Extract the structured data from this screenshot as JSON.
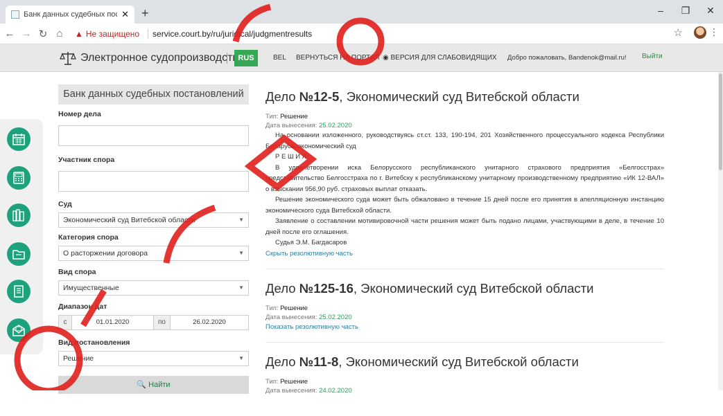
{
  "browser": {
    "tab_title": "Банк данных судебных постано",
    "tab_close": "✕",
    "newtab": "+",
    "win_min": "–",
    "win_max": "❐",
    "win_close": "✕",
    "security_label": "Не защищено",
    "url": "service.court.by/ru/juridical/judgmentresults"
  },
  "header": {
    "brand": "Электронное судопроизводство",
    "lang_rus": "RUS",
    "lang_bel": "BEL",
    "back_portal": "ВЕРНУТЬСЯ НА ПОРТАЛ",
    "low_vision": "◉ ВЕРСИЯ ДЛЯ СЛАБОВИДЯЩИХ",
    "welcome": "Добро пожаловать, Bandenok@mail.ru!",
    "logout": "Выйти"
  },
  "sidebar_icons": [
    "calendar-icon",
    "calculator-icon",
    "books-icon",
    "folder-icon",
    "document-icon",
    "envelope-icon"
  ],
  "form": {
    "title": "Банк данных судебных постановлений",
    "case_number_label": "Номер дела",
    "participant_label": "Участник спора",
    "court_label": "Суд",
    "court_value": "Экономический суд Витебской области",
    "category_label": "Категория спора",
    "category_value": "О расторжении договора",
    "dispute_type_label": "Вид спора",
    "dispute_type_value": "Имущественные",
    "date_range_label": "Диапазон дат",
    "date_from_addon": "с",
    "date_from": "01.01.2020",
    "date_to_addon": "по",
    "date_to": "26.02.2020",
    "ruling_type_label": "Вид постановления",
    "ruling_type_value": "Решение",
    "search_button": "🔍 Найти"
  },
  "results": [
    {
      "title_prefix": "Дело ",
      "number": "№12-5",
      "title_suffix": ", Экономический суд Витебской области",
      "type_label": "Тип: ",
      "type_value": "Решение",
      "date_label": "Дата вынесения: ",
      "date_value": "25.02.2020",
      "paragraphs": [
        "На основании изложенного, руководствуясь ст.ст. 133, 190-194, 201 Хозяйственного процессуального кодекса Республики Беларусь, экономический суд",
        "Р Е Ш И Л:",
        "В удовлетворении иска Белорусского республиканского унитарного страхового предприятия «Белгосстрах» представительство Белгосстраха по г. Витебску к республиканскому унитарному производственному предприятию «ИК 12-ВАЛ» о взыскании 956,90 руб. страховых выплат отказать.",
        "Решение экономического суда может быть обжаловано в течение 15 дней после его принятия в апелляционную инстанцию экономического суда Витебской области.",
        "Заявление о составлении мотивировочной части решения может быть подано лицами, участвующими в деле, в течение 10 дней после его оглашения.",
        "Судья Э.М. Багдасаров"
      ],
      "toggle": "Скрыть резолютивную часть"
    },
    {
      "title_prefix": "Дело ",
      "number": "№125-16",
      "title_suffix": ", Экономический суд Витебской области",
      "type_label": "Тип: ",
      "type_value": "Решение",
      "date_label": "Дата вынесения: ",
      "date_value": "25.02.2020",
      "toggle": "Показать резолютивную часть"
    },
    {
      "title_prefix": "Дело ",
      "number": "№11-8",
      "title_suffix": ", Экономический суд Витебской области",
      "type_label": "Тип: ",
      "type_value": "Решение",
      "date_label": "Дата вынесения: ",
      "date_value": "24.02.2020"
    }
  ],
  "colors": {
    "accent": "#1ea27d",
    "lang_active": "#34a853",
    "date": "#2a9d5a",
    "link": "#2a7f9e",
    "watermark": "#e0201c"
  }
}
